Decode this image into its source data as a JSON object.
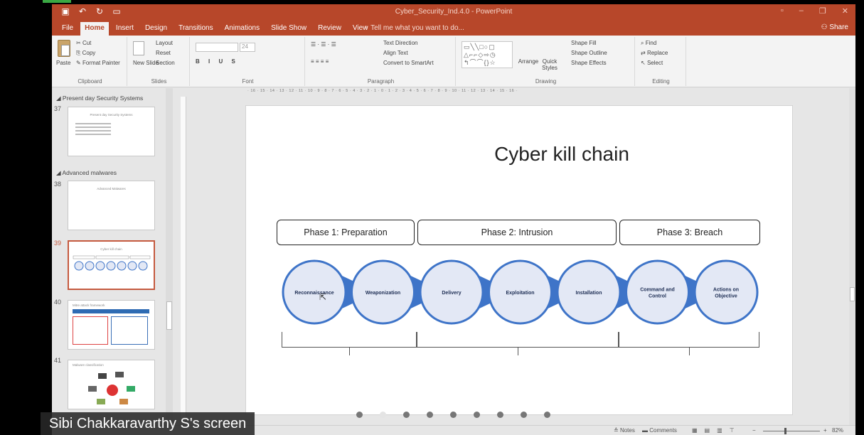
{
  "app": {
    "doc_title": "Cyber_Security_Ind.4.0 - PowerPoint",
    "share": "Share",
    "tell_me": "Tell me what you want to do...",
    "colors": {
      "accent": "#b7472a",
      "selected_slide": "#c55a3f",
      "chain_fill": "#e3e8f5",
      "chain_outline": "#3e74c8"
    }
  },
  "tabs": [
    "File",
    "Home",
    "Insert",
    "Design",
    "Transitions",
    "Animations",
    "Slide Show",
    "Review",
    "View"
  ],
  "active_tab": "Home",
  "ribbon": {
    "clipboard": {
      "label": "Clipboard",
      "paste": "Paste",
      "cut": "Cut",
      "copy": "Copy",
      "format_painter": "Format Painter"
    },
    "slides": {
      "label": "Slides",
      "new_slide": "New Slide",
      "layout": "Layout",
      "reset": "Reset",
      "section": "Section"
    },
    "font": {
      "label": "Font",
      "size": "24"
    },
    "paragraph": {
      "label": "Paragraph",
      "text_direction": "Text Direction",
      "align_text": "Align Text",
      "convert_smartart": "Convert to SmartArt"
    },
    "drawing": {
      "label": "Drawing",
      "arrange": "Arrange",
      "quick_styles": "Quick Styles",
      "shape_fill": "Shape Fill",
      "shape_outline": "Shape Outline",
      "shape_effects": "Shape Effects"
    },
    "editing": {
      "label": "Editing",
      "find": "Find",
      "replace": "Replace",
      "select": "Select"
    }
  },
  "panel": {
    "sections": [
      "Present day Security Systems",
      "Advanced malwares"
    ],
    "thumbs": [
      {
        "num": "37",
        "title": "Present day Security Systems"
      },
      {
        "num": "38",
        "title": "Advanced Malwares"
      },
      {
        "num": "39",
        "title": "Cyber kill chain"
      },
      {
        "num": "40",
        "title": "Mitre attack framework"
      },
      {
        "num": "41",
        "title": "Malware classification"
      }
    ]
  },
  "ruler": "· 16 · 15 · 14 · 13 · 12 · 11 · 10 · 9 · 8 · 7 · 6 · 5 · 4 · 3 · 2 · 1 · 0 · 1 · 2 · 3 · 4 · 5 · 6 · 7 · 8 · 9 · 10 · 11 · 12 · 13 · 14 · 15 · 16 ·",
  "slide": {
    "title": "Cyber kill chain",
    "phases": [
      "Phase 1: Preparation",
      "Phase 2: Intrusion",
      "Phase 3: Breach"
    ],
    "steps": [
      "Reconnaissance",
      "Weaponization",
      "Delivery",
      "Exploitation",
      "Installation",
      "Command and Control",
      "Actions on Objective"
    ]
  },
  "status": {
    "notes": "Notes",
    "comments": "Comments",
    "zoom": "82%"
  },
  "caption": "Sibi Chakkaravarthy S's screen"
}
